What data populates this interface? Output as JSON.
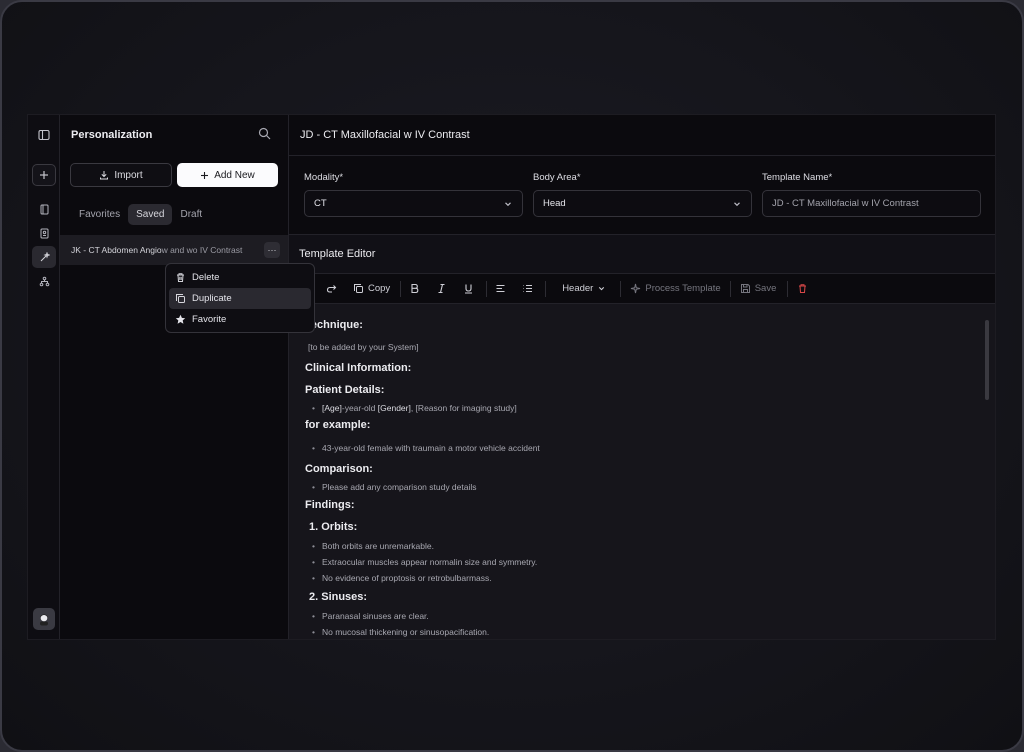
{
  "sidebar": {
    "title": "Personalization",
    "import_label": "Import",
    "add_new_label": "Add New",
    "tabs": [
      {
        "label": "Favorites"
      },
      {
        "label": "Saved"
      },
      {
        "label": "Draft"
      }
    ],
    "list_item": {
      "title_main": "JK - CT Abdomen Angio",
      "title_rest": " w and wo IV Contrast",
      "more_label": "···"
    },
    "context_menu": {
      "delete": "Delete",
      "duplicate": "Duplicate",
      "favorite": "Favorite"
    }
  },
  "main": {
    "title": "JD - CT Maxillofacial w IV Contrast",
    "form": {
      "modality_label": "Modality*",
      "modality_value": "CT",
      "body_area_label": "Body Area*",
      "body_area_value": "Head",
      "template_name_label": "Template Name*",
      "template_name_value": "JD - CT Maxillofacial w IV Contrast"
    },
    "editor_title": "Template Editor",
    "toolbar": {
      "copy": "Copy",
      "header": "Header",
      "process": "Process Template",
      "save": "Save"
    },
    "content": {
      "technique_h": "Technique:",
      "technique_p": "[to be added by your System]",
      "clinical_h": "Clinical Information:",
      "patient_h": "Patient Details:",
      "patient_age": "[Age]",
      "patient_mid": "-year-old ",
      "patient_gender": "[Gender]",
      "patient_end": ", [Reason for imaging study]",
      "example_h": "for example:",
      "example_li": "43-year-old female with traumain a motor vehicle accident",
      "comparison_h": "Comparison:",
      "comparison_li": "Please add any comparison study details",
      "findings_h": "Findings:",
      "orbits_h": "1. Orbits:",
      "orbits_li": [
        "Both orbits are unremarkable.",
        "Extraocular muscles appear normalin size and symmetry.",
        "No evidence of proptosis or retrobulbarmass."
      ],
      "sinuses_h": "2. Sinuses:",
      "sinuses_li": [
        "Paranasal sinuses are clear.",
        "No mucosal thickening or sinusopacification."
      ]
    }
  }
}
